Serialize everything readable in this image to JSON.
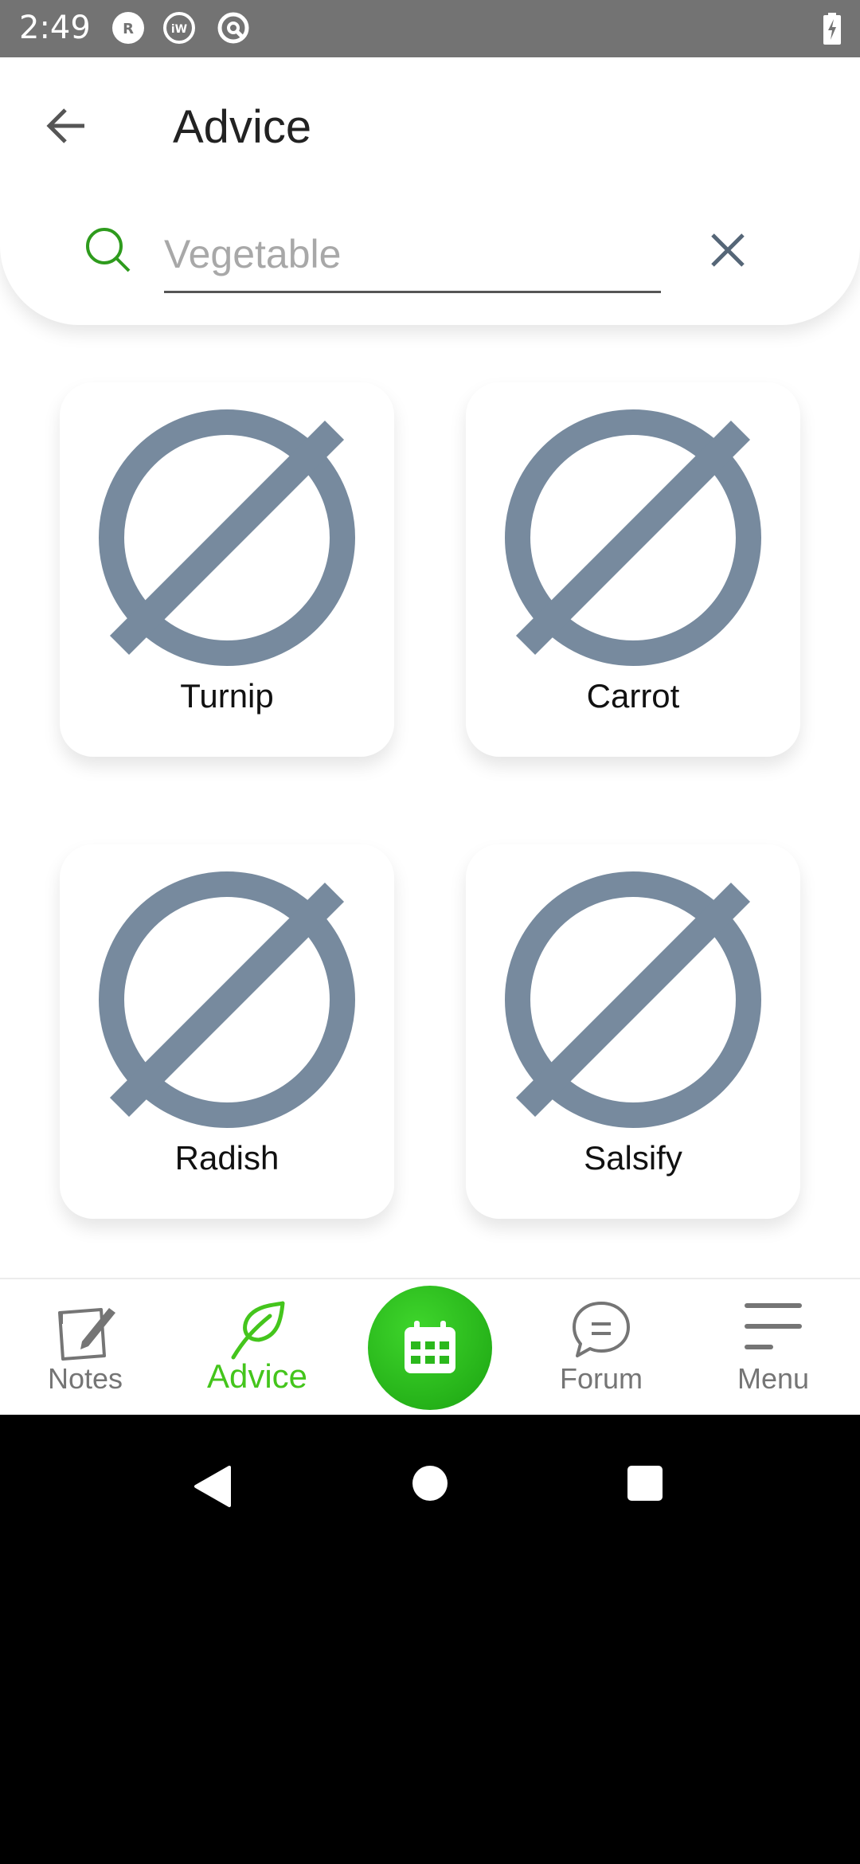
{
  "status_bar": {
    "time": "2:49",
    "icons": [
      "r-badge-icon",
      "iw-badge-icon",
      "circle-logo-icon"
    ],
    "badges": {
      "r": "R",
      "iw": "iW"
    },
    "battery": "battery-charging-icon"
  },
  "header": {
    "title": "Advice",
    "back_icon": "back-arrow-icon"
  },
  "search": {
    "value": "",
    "placeholder": "Vegetable",
    "search_icon": "search-icon",
    "clear_icon": "close-icon"
  },
  "vegetables": [
    {
      "label": "Turnip",
      "icon": "no-image-icon"
    },
    {
      "label": "Carrot",
      "icon": "no-image-icon"
    },
    {
      "label": "Radish",
      "icon": "no-image-icon"
    },
    {
      "label": "Salsify",
      "icon": "no-image-icon"
    }
  ],
  "bottom_nav": {
    "items": [
      {
        "label": "Notes",
        "icon": "notes-icon"
      },
      {
        "label": "Advice",
        "icon": "leaf-icon",
        "active": true
      },
      {
        "label": "",
        "icon": "calendar-icon"
      },
      {
        "label": "Forum",
        "icon": "chat-bubble-icon"
      },
      {
        "label": "Menu",
        "icon": "hamburger-menu-icon"
      }
    ]
  },
  "colors": {
    "accent_green": "#44c51c",
    "icon_gray": "#778a9e",
    "nav_gray": "#757575",
    "status_bar": "#737373"
  }
}
